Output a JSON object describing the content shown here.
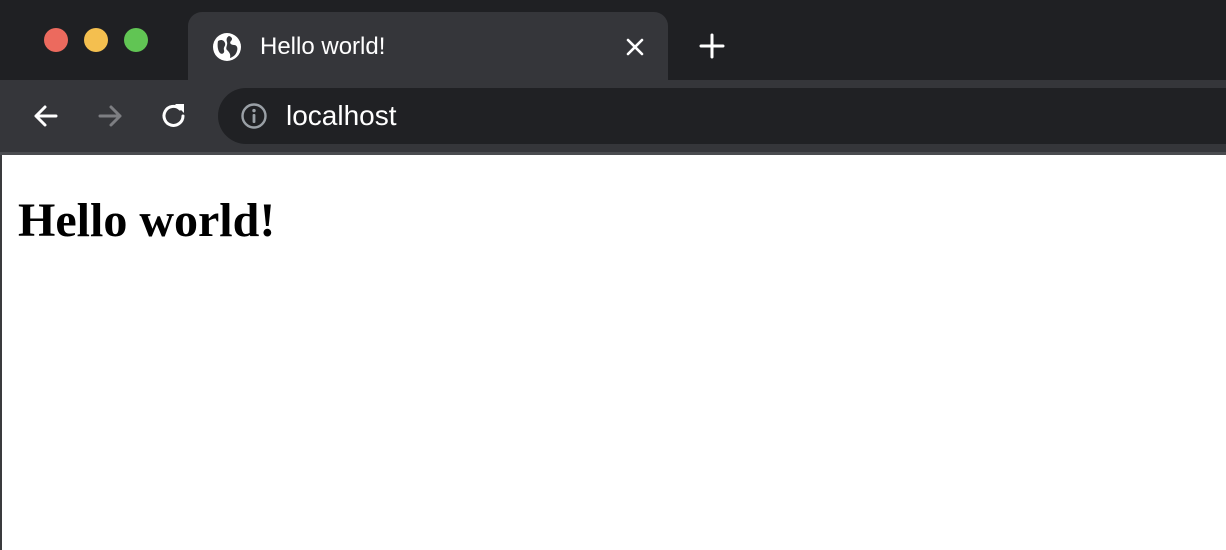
{
  "window": {
    "traffic_lights": {
      "close_color": "#ec6a5e",
      "minimize_color": "#f4bf4f",
      "maximize_color": "#61c554"
    }
  },
  "tabs": [
    {
      "title": "Hello world!",
      "favicon": "globe-icon",
      "active": true
    }
  ],
  "toolbar": {
    "back_icon": "arrow-left-icon",
    "forward_icon": "arrow-right-icon",
    "reload_icon": "reload-icon",
    "site_info_icon": "info-icon",
    "address": "localhost"
  },
  "page": {
    "heading": "Hello world!"
  },
  "colors": {
    "tabstrip_bg": "#1f2023",
    "tab_active_bg": "#35363a",
    "omnibox_bg": "#202124",
    "page_bg": "#ffffff"
  }
}
